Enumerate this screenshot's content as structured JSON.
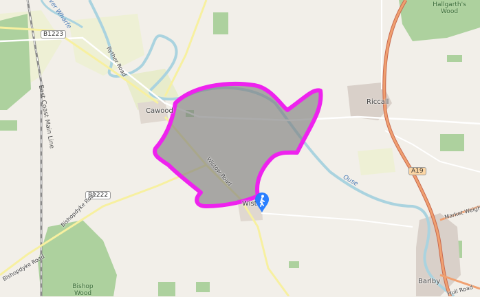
{
  "places": {
    "cawood": "Cawood",
    "riccall": "Riccall",
    "barlby": "Barlby",
    "wistow": "Wistow"
  },
  "roads": {
    "b1223": "B1223",
    "b1222": "B1222",
    "a19": "A19",
    "bishopdyke_road_upper": "Bishopdyke Road",
    "bishopdyke_road_lower": "Bishopdyke Road",
    "wistow_road": "Wistow Road",
    "market_weighton_road": "Market Weighton Road",
    "hull_road": "Hull Road",
    "ryther_road": "Ryther Road"
  },
  "water": {
    "river_wharfe": "River Wharfe",
    "ouse": "Ouse"
  },
  "rail": {
    "east_coast_main_line": "East Coast Main Line"
  },
  "woods": {
    "hallgarth_wood": "Hallgarth's Wood",
    "bishop_wood": "Bishop Wood"
  },
  "icons": {
    "marker": "hiker-marker-icon"
  },
  "colors": {
    "area_outline": "#ee22ee",
    "area_fill": "#808080",
    "a_road": "#f0a070",
    "b_road": "#f7f0a0",
    "water": "#aad3df",
    "woodland": "#add19e",
    "marker": "#2a7fff"
  }
}
